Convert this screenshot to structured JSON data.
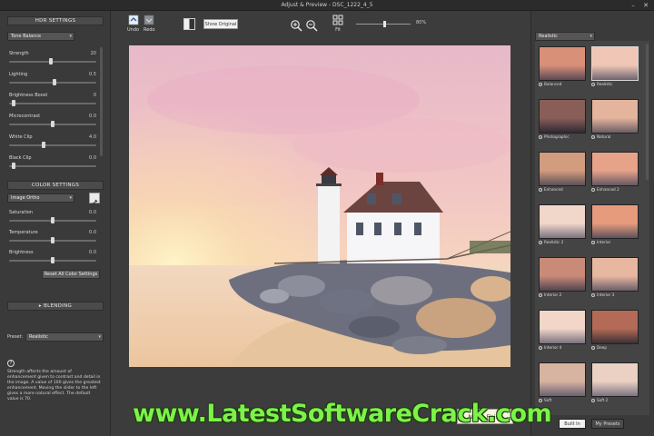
{
  "window": {
    "title": "Adjust & Preview - DSC_1222_4_5"
  },
  "left_panel": {
    "hdr_title": "HDR SETTINGS",
    "hdr_preset": "Tone Balance",
    "hdr_sliders": [
      {
        "label": "Strength",
        "value": "20",
        "level": 0.48
      },
      {
        "label": "Lighting",
        "value": "0.5",
        "level": 0.52
      },
      {
        "label": "Brightness Boost",
        "value": "0",
        "level": 0.05
      },
      {
        "label": "Microcontrast",
        "value": "0.0",
        "level": 0.5
      },
      {
        "label": "White Clip",
        "value": "4.0",
        "level": 0.4
      },
      {
        "label": "Black Clip",
        "value": "0.0",
        "level": 0.05
      }
    ],
    "color_title": "COLOR SETTINGS",
    "color_preset": "Image Ortho",
    "color_sliders": [
      {
        "label": "Saturation",
        "value": "0.0",
        "level": 0.5
      },
      {
        "label": "Temperature",
        "value": "0.0",
        "level": 0.5
      },
      {
        "label": "Brightness",
        "value": "0.0",
        "level": 0.5
      }
    ],
    "reset_label": "Reset All Color Settings",
    "blending_title": "▸ BLENDING",
    "preset_label": "Preset:",
    "preset_value": "Realistic",
    "help_icon": "?",
    "help_text": "Strength affects the amount of enhancement given to contrast and detail in the image. A value of 100 gives the greatest enhancement. Moving the slider to the left gives a more natural effect. The default value is 70."
  },
  "toolbar": {
    "undo_label": "Undo",
    "redo_label": "Redo",
    "show_original_label": "Show Original",
    "fit_label": "Fit",
    "zoom_value": "80%",
    "zoom_level": 0.5
  },
  "bottom": {
    "next_label": "Next : Finish"
  },
  "right_panel": {
    "category": "Realistic",
    "presets": [
      {
        "name": "Balanced",
        "selected": false
      },
      {
        "name": "Realistic",
        "selected": true
      },
      {
        "name": "Photographic",
        "selected": false
      },
      {
        "name": "Natural",
        "selected": false
      },
      {
        "name": "Enhanced",
        "selected": false
      },
      {
        "name": "Enhanced 2",
        "selected": false
      },
      {
        "name": "Realistic 2",
        "selected": false
      },
      {
        "name": "Interior",
        "selected": false
      },
      {
        "name": "Interior 2",
        "selected": false
      },
      {
        "name": "Interior 3",
        "selected": false
      },
      {
        "name": "Interior 4",
        "selected": false
      },
      {
        "name": "Deep",
        "selected": false
      },
      {
        "name": "Soft",
        "selected": false
      },
      {
        "name": "Soft 2",
        "selected": false
      }
    ],
    "tab_builtin": "Built In",
    "tab_mypresets": "My Presets"
  },
  "watermark": "www.LatestSoftwareCrack.com"
}
